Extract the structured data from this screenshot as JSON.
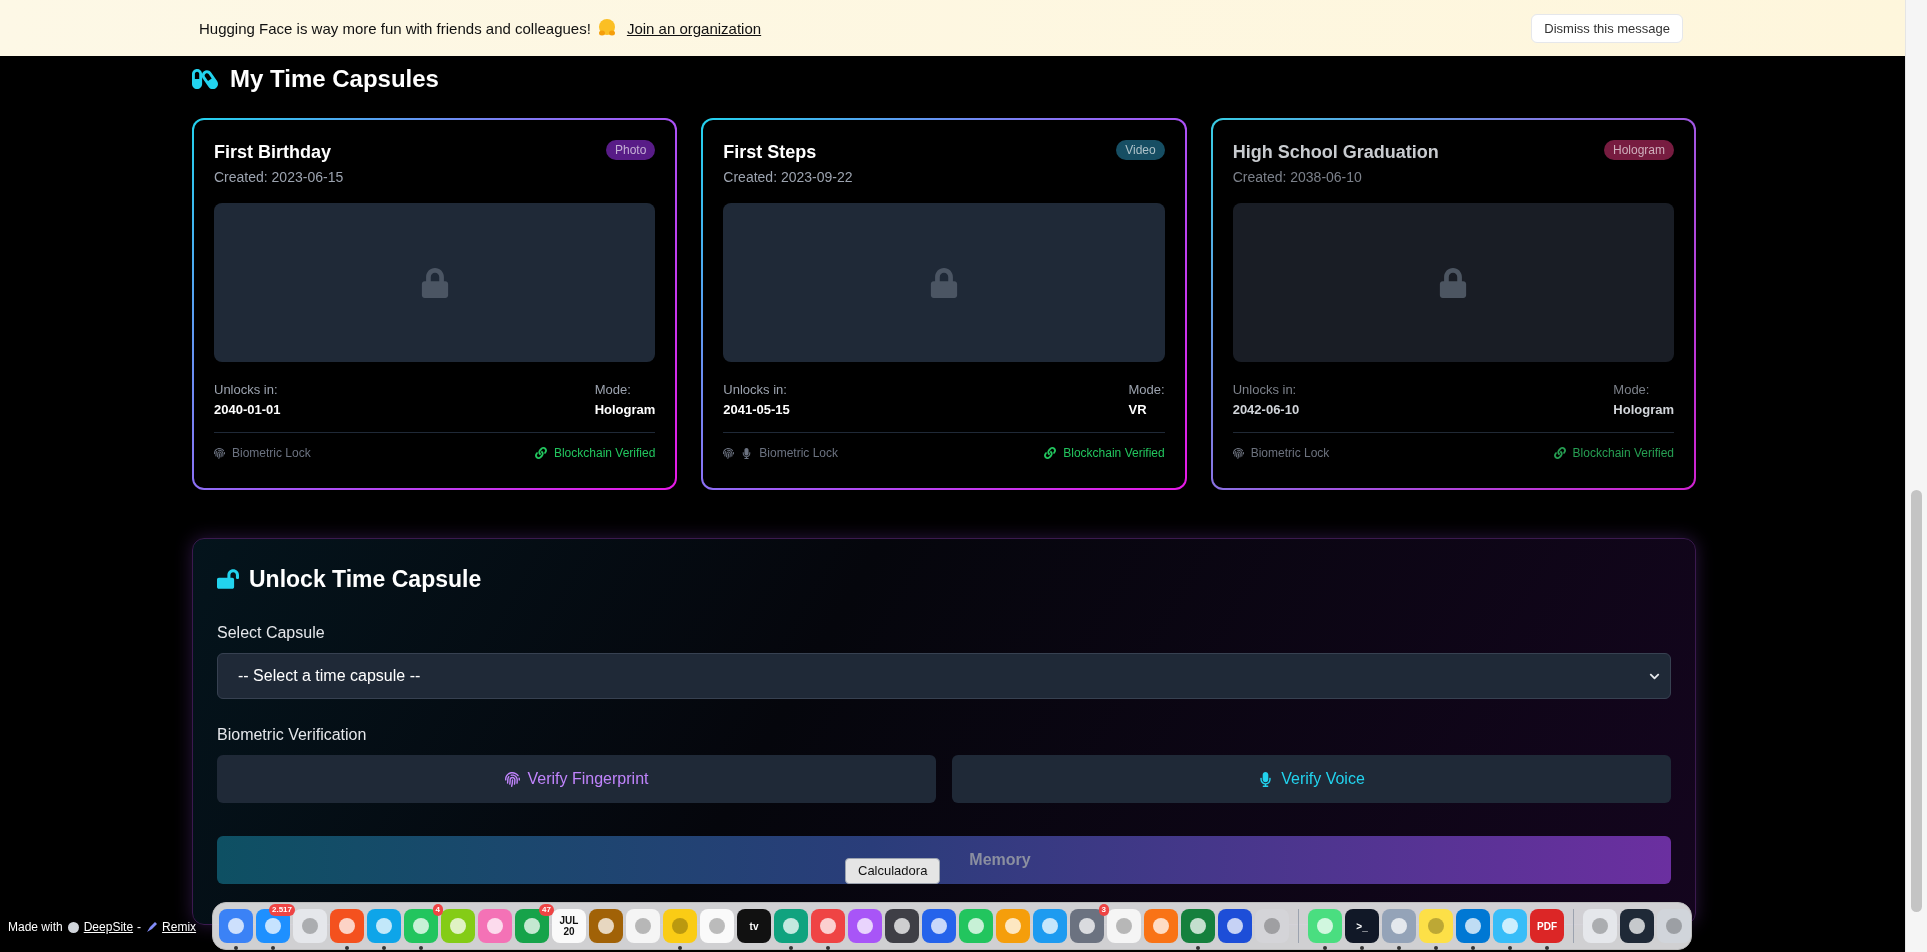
{
  "banner": {
    "message": "Hugging Face is way more fun with friends and colleagues!",
    "link": "Join an organization",
    "dismiss": "Dismiss this message"
  },
  "heading": "My Time Capsules",
  "capsules": [
    {
      "title": "First Birthday",
      "created": "Created: 2023-06-15",
      "type": {
        "label": "Photo",
        "color": "#581c87"
      },
      "unlocks_label": "Unlocks in:",
      "unlock_date": "2040-01-01",
      "mode_label": "Mode:",
      "mode": "Hologram",
      "locks": [
        {
          "kind": "fingerprint"
        }
      ],
      "lock_label": "Biometric Lock",
      "verified": "Blockchain Verified",
      "dimmed": false
    },
    {
      "title": "First Steps",
      "created": "Created: 2023-09-22",
      "type": {
        "label": "Video",
        "color": "#164e63"
      },
      "unlocks_label": "Unlocks in:",
      "unlock_date": "2041-05-15",
      "mode_label": "Mode:",
      "mode": "VR",
      "locks": [
        {
          "kind": "fingerprint"
        },
        {
          "kind": "voice"
        }
      ],
      "lock_label": "Biometric Lock",
      "verified": "Blockchain Verified",
      "dimmed": false
    },
    {
      "title": "High School Graduation",
      "created": "Created: 2038-06-10",
      "type": {
        "label": "Hologram",
        "color": "#831843"
      },
      "unlocks_label": "Unlocks in:",
      "unlock_date": "2042-06-10",
      "mode_label": "Mode:",
      "mode": "Hologram",
      "locks": [
        {
          "kind": "fingerprint"
        }
      ],
      "lock_label": "Biometric Lock",
      "verified": "Blockchain Verified",
      "dimmed": true
    }
  ],
  "unlock": {
    "title": "Unlock Time Capsule",
    "select_label": "Select Capsule",
    "select_placeholder": "-- Select a time capsule --",
    "biometric_label": "Biometric Verification",
    "buttons": [
      {
        "kind": "fingerprint",
        "label": "Verify Fingerprint"
      },
      {
        "kind": "voice",
        "label": "Verify Voice"
      }
    ],
    "submit": {
      "label": "Memory",
      "disabled": true
    }
  },
  "tooltip": "Calculadora",
  "footer": {
    "prefix": "Made with",
    "links": [
      "DeepSite",
      "Remix"
    ],
    "separator": "-"
  },
  "dock": [
    {
      "kind": "app",
      "color": "#3b82f6",
      "running": true
    },
    {
      "kind": "app",
      "color": "#1e90ff",
      "running": true,
      "badge": "2.517"
    },
    {
      "kind": "app",
      "color": "#e5e7eb",
      "running": false
    },
    {
      "kind": "app",
      "color": "#f4511e",
      "running": true
    },
    {
      "kind": "app",
      "color": "#0ea5e9",
      "running": true
    },
    {
      "kind": "app",
      "color": "#22c55e",
      "running": true,
      "badge": "4"
    },
    {
      "kind": "app",
      "color": "#84cc16",
      "running": false
    },
    {
      "kind": "app",
      "color": "#f472b6",
      "running": false
    },
    {
      "kind": "app",
      "color": "#16a34a",
      "running": false,
      "badge": "47"
    },
    {
      "kind": "app",
      "color": "#fafafa",
      "running": false,
      "glyphs": [
        "JUL",
        "20"
      ]
    },
    {
      "kind": "app",
      "color": "#a16207",
      "running": false
    },
    {
      "kind": "app",
      "color": "#f5f5f5",
      "running": false
    },
    {
      "kind": "app",
      "color": "#facc15",
      "running": true
    },
    {
      "kind": "app",
      "color": "#fafafa",
      "running": false
    },
    {
      "kind": "app",
      "color": "#111111",
      "running": false,
      "glyphs": [
        "tv"
      ]
    },
    {
      "kind": "app",
      "color": "#10a37f",
      "running": true
    },
    {
      "kind": "app",
      "color": "#ef4444",
      "running": true
    },
    {
      "kind": "app",
      "color": "#a855f7",
      "running": false
    },
    {
      "kind": "app",
      "color": "#3f3f46",
      "running": false
    },
    {
      "kind": "app",
      "color": "#2563eb",
      "running": false
    },
    {
      "kind": "app",
      "color": "#22c55e",
      "running": false
    },
    {
      "kind": "app",
      "color": "#f59e0b",
      "running": false
    },
    {
      "kind": "app",
      "color": "#1d9bf0",
      "running": false
    },
    {
      "kind": "app",
      "color": "#6b7280",
      "running": false,
      "badge": "3"
    },
    {
      "kind": "app",
      "color": "#f5f5f5",
      "running": false
    },
    {
      "kind": "app",
      "color": "#f97316",
      "running": false
    },
    {
      "kind": "app",
      "color": "#15803d",
      "running": true
    },
    {
      "kind": "app",
      "color": "#1d4ed8",
      "running": false
    },
    {
      "kind": "app",
      "color": "#d4d4d8",
      "running": false
    },
    {
      "kind": "separator"
    },
    {
      "kind": "app",
      "color": "#4ade80",
      "running": true
    },
    {
      "kind": "app",
      "color": "#111827",
      "running": true,
      "glyphs": [
        ">_"
      ]
    },
    {
      "kind": "app",
      "color": "#94a3b8",
      "running": true
    },
    {
      "kind": "app",
      "color": "#fde047",
      "running": true
    },
    {
      "kind": "app",
      "color": "#0078d4",
      "running": true
    },
    {
      "kind": "app",
      "color": "#38bdf8",
      "running": true
    },
    {
      "kind": "app",
      "color": "#dc2626",
      "running": true,
      "glyphs": [
        "PDF"
      ]
    },
    {
      "kind": "separator"
    },
    {
      "kind": "app",
      "color": "#e5e7eb",
      "running": false
    },
    {
      "kind": "app",
      "color": "#1f2937",
      "running": false
    },
    {
      "kind": "app",
      "color": "#d1d5db",
      "running": false
    }
  ]
}
